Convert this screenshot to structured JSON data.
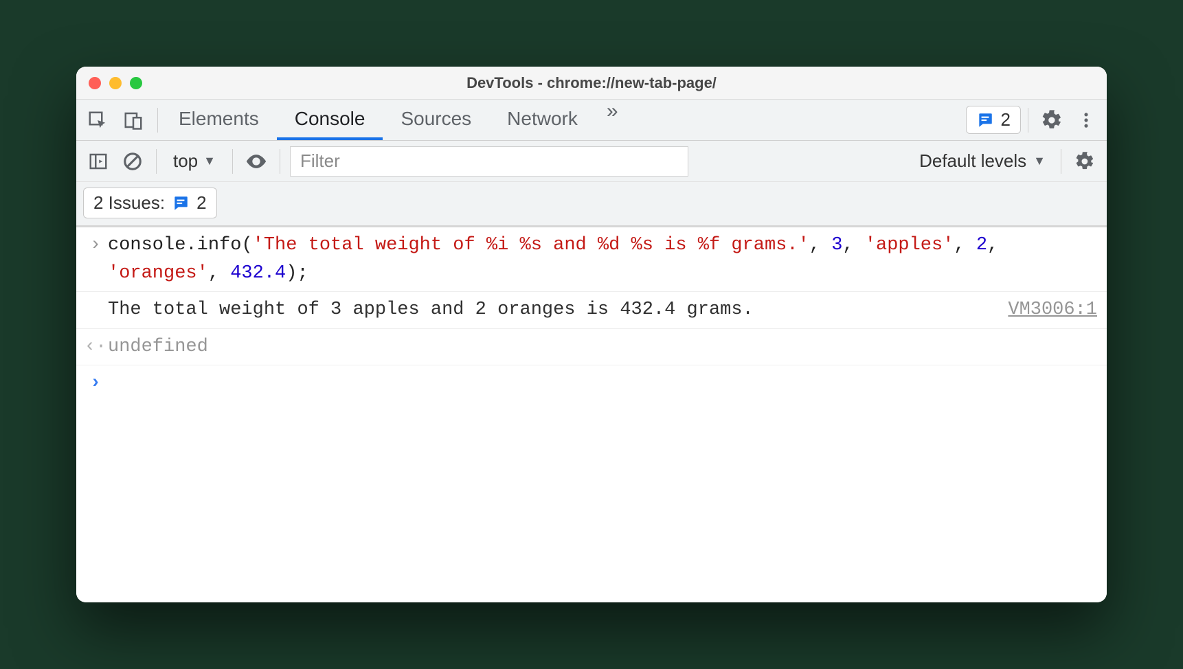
{
  "window": {
    "title": "DevTools - chrome://new-tab-page/"
  },
  "tabs": {
    "items": [
      "Elements",
      "Console",
      "Sources",
      "Network"
    ],
    "active_index": 1,
    "overflow_glyph": "»"
  },
  "tabbar_right": {
    "issues_count": "2"
  },
  "console_toolbar": {
    "context_label": "top",
    "filter_placeholder": "Filter",
    "levels_label": "Default levels"
  },
  "issues_row": {
    "prefix": "2 Issues:",
    "count": "2"
  },
  "console": {
    "input_code": {
      "parts": [
        {
          "t": "obj",
          "v": "console"
        },
        {
          "t": "pun",
          "v": "."
        },
        {
          "t": "func",
          "v": "info"
        },
        {
          "t": "pun",
          "v": "("
        },
        {
          "t": "str",
          "v": "'The total weight of %i %s and %d %s is %f grams.'"
        },
        {
          "t": "pun",
          "v": ", "
        },
        {
          "t": "num",
          "v": "3"
        },
        {
          "t": "pun",
          "v": ", "
        },
        {
          "t": "str",
          "v": "'apples'"
        },
        {
          "t": "pun",
          "v": ", "
        },
        {
          "t": "num",
          "v": "2"
        },
        {
          "t": "pun",
          "v": ", "
        },
        {
          "t": "str",
          "v": "'oranges'"
        },
        {
          "t": "pun",
          "v": ", "
        },
        {
          "t": "num",
          "v": "432.4"
        },
        {
          "t": "pun",
          "v": ");"
        }
      ]
    },
    "output_text": "The total weight of 3 apples and 2 oranges is 432.4 grams.",
    "output_source": "VM3006:1",
    "return_value": "undefined",
    "gutters": {
      "input": "›",
      "output": "",
      "return": "‹·",
      "prompt": "›"
    }
  }
}
